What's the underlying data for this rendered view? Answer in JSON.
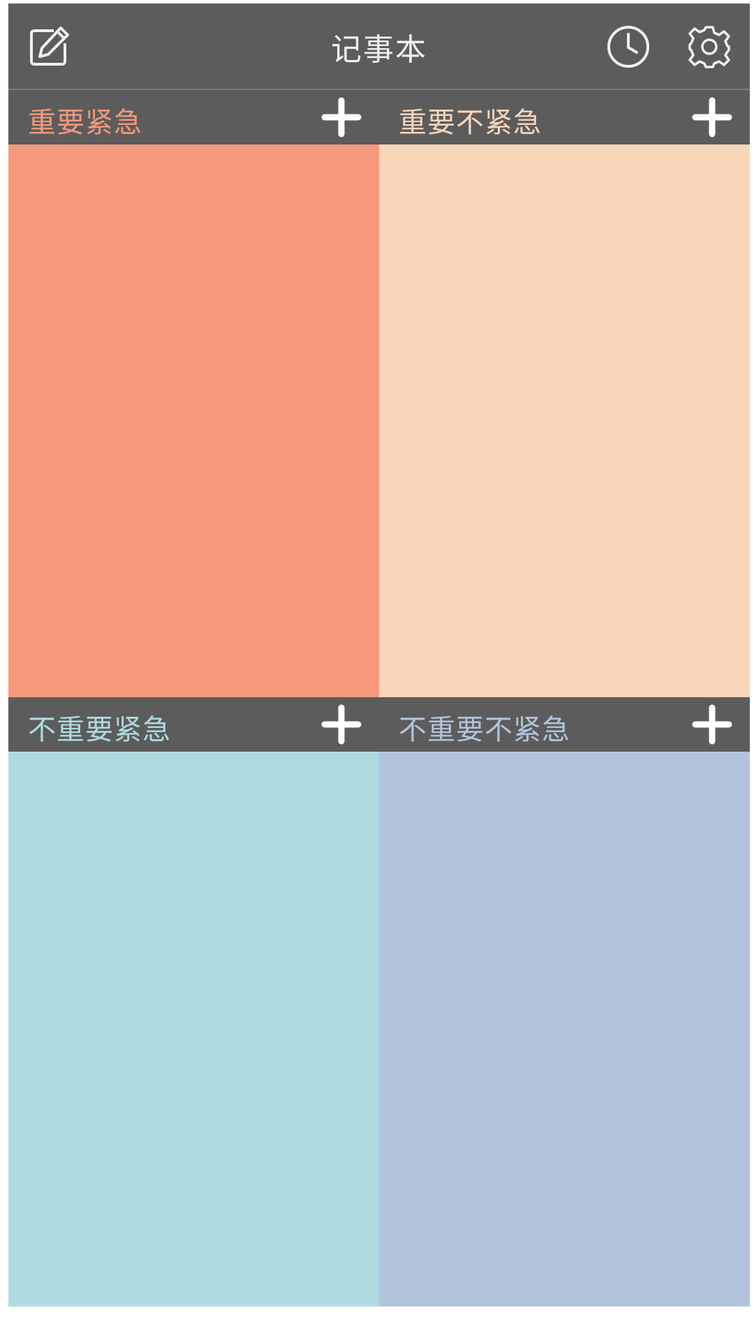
{
  "header": {
    "title": "记事本",
    "edit_icon": "edit-icon",
    "history_icon": "clock-icon",
    "settings_icon": "gear-icon"
  },
  "quadrants": [
    {
      "label": "重要紧急",
      "label_color": "#f4977a",
      "bg_color": "#f5987b",
      "add_icon": "plus-icon"
    },
    {
      "label": "重要不紧急",
      "label_color": "#f8d6b9",
      "bg_color": "#f8d6b9",
      "add_icon": "plus-icon"
    },
    {
      "label": "不重要紧急",
      "label_color": "#b0dae1",
      "bg_color": "#b0dae1",
      "add_icon": "plus-icon"
    },
    {
      "label": "不重要不紧急",
      "label_color": "#b2c4dd",
      "bg_color": "#b2c4dd",
      "add_icon": "plus-icon"
    }
  ],
  "colors": {
    "bar": "#5c5c5c",
    "icon": "#f0f0f0"
  }
}
